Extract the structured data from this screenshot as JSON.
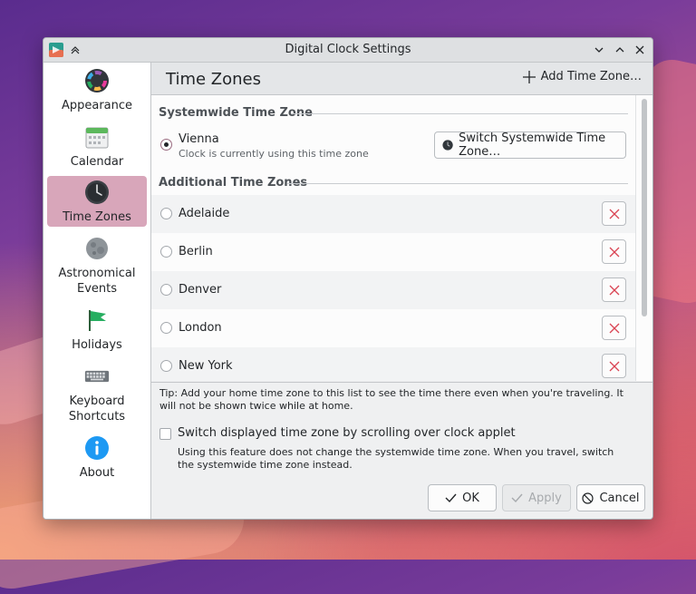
{
  "window": {
    "title": "Digital Clock Settings"
  },
  "sidebar": {
    "items": [
      {
        "label": "Appearance",
        "icon": "appearance-color-wheel-icon"
      },
      {
        "label": "Calendar",
        "icon": "calendar-icon"
      },
      {
        "label": "Time Zones",
        "icon": "clock-icon",
        "selected": true
      },
      {
        "label": "Astronomical\nEvents",
        "icon": "moon-icon"
      },
      {
        "label": "Holidays",
        "icon": "flag-icon"
      },
      {
        "label": "Keyboard\nShortcuts",
        "icon": "keyboard-icon"
      },
      {
        "label": "About",
        "icon": "info-icon"
      }
    ]
  },
  "header": {
    "title": "Time Zones",
    "add_label": "Add Time Zone…"
  },
  "systemwide": {
    "heading": "Systemwide Time Zone",
    "name": "Vienna",
    "subtitle": "Clock is currently using this time zone",
    "switch_label": "Switch Systemwide Time Zone…"
  },
  "additional": {
    "heading": "Additional Time Zones",
    "zones": [
      "Adelaide",
      "Berlin",
      "Denver",
      "London",
      "New York"
    ]
  },
  "tip": "Tip: Add your home time zone to this list to see the time there even when you're traveling. It will not be shown twice while at home.",
  "scroll_option": {
    "label": "Switch displayed time zone by scrolling over clock applet",
    "checked": false,
    "help": "Using this feature does not change the systemwide time zone. When you travel, switch the systemwide time zone instead."
  },
  "buttons": {
    "ok": "OK",
    "apply": "Apply",
    "cancel": "Cancel"
  },
  "colors": {
    "selection": "#d8a6ba",
    "delete_red": "#da4453",
    "accent": "#9a6b80"
  }
}
